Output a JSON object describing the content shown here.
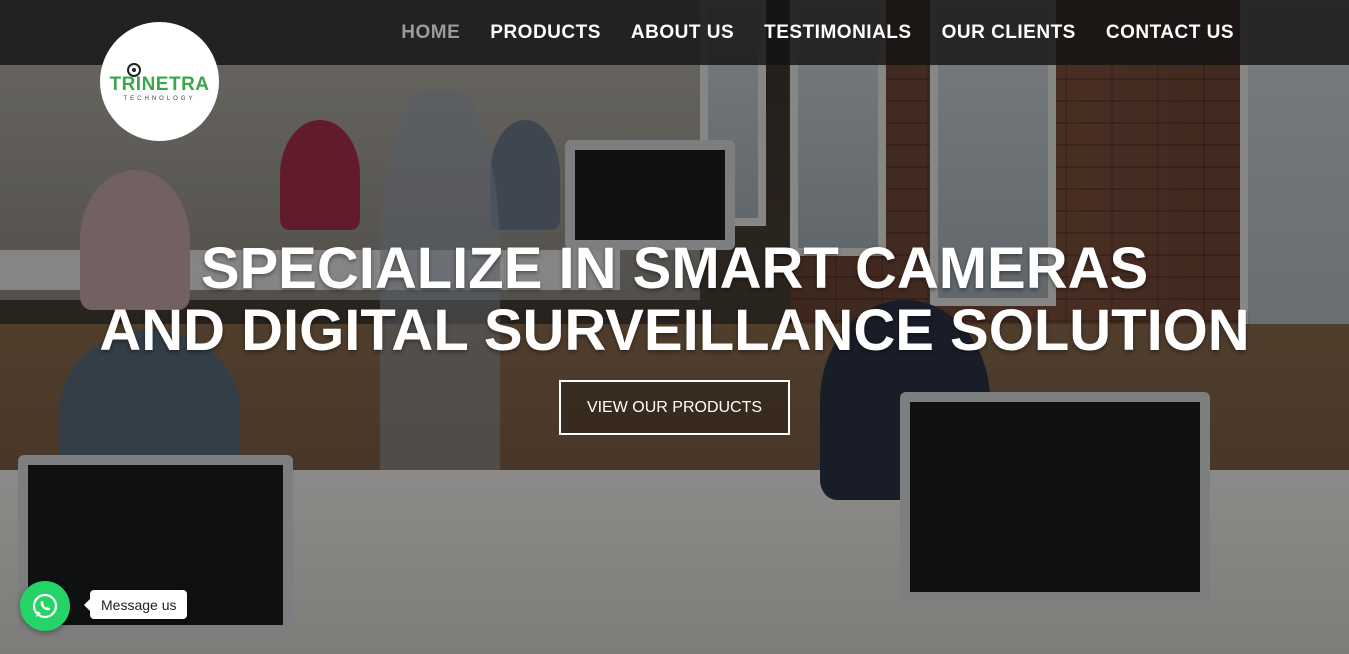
{
  "brand": {
    "name": "TRINETRA",
    "tagline": "TECHNOLOGY",
    "accent_color": "#3aa84a"
  },
  "nav": {
    "items": [
      {
        "label": "HOME",
        "active": true
      },
      {
        "label": "PRODUCTS",
        "active": false
      },
      {
        "label": "ABOUT US",
        "active": false
      },
      {
        "label": "TESTIMONIALS",
        "active": false
      },
      {
        "label": "OUR CLIENTS",
        "active": false
      },
      {
        "label": "CONTACT US",
        "active": false
      }
    ]
  },
  "hero": {
    "title_line1": "SPECIALIZE IN SMART CAMERAS",
    "title_line2": "AND DIGITAL SURVEILLANCE SOLUTION",
    "cta_label": "VIEW OUR PRODUCTS",
    "background": "office-photo"
  },
  "whatsapp": {
    "icon": "whatsapp-icon",
    "label": "Message us",
    "color": "#25d366"
  }
}
